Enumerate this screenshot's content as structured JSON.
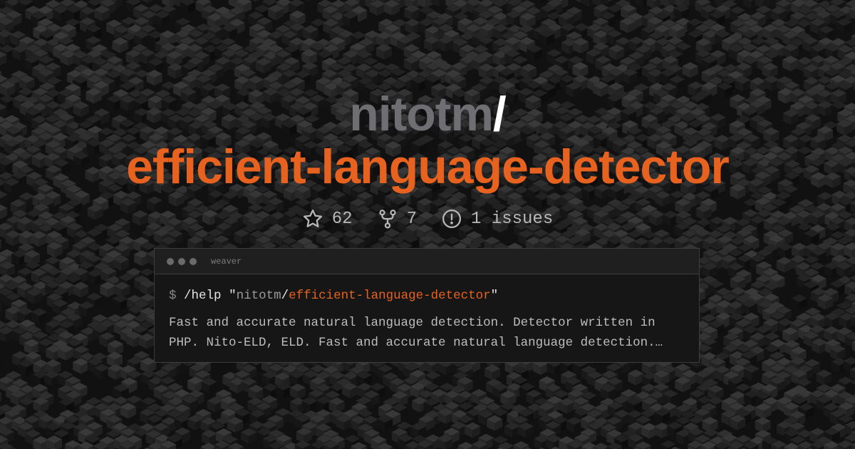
{
  "colors": {
    "background": "#111111",
    "owner": "#6e6e73",
    "accent": "#e8621f",
    "slash": "#ffffff",
    "stat_text": "#b8b8b8",
    "terminal_bg": "#161616",
    "terminal_border": "#3c3c3c"
  },
  "repo": {
    "owner": "nitotm",
    "slash": "/",
    "name": "efficient-language-detector"
  },
  "stats": [
    {
      "icon": "star-icon",
      "value": "62"
    },
    {
      "icon": "fork-icon",
      "value": "7"
    },
    {
      "icon": "issue-icon",
      "value": "1 issues"
    }
  ],
  "terminal": {
    "title": "weaver",
    "prompt": "$",
    "command": "/help",
    "quote_open": "\"",
    "arg_owner": "nitotm",
    "arg_slash": "/",
    "arg_repo": "efficient-language-detector",
    "quote_close": "\"",
    "description": "Fast and accurate natural language detection. Detector written in PHP. Nito-ELD, ELD. Fast and accurate natural language detection.…"
  }
}
